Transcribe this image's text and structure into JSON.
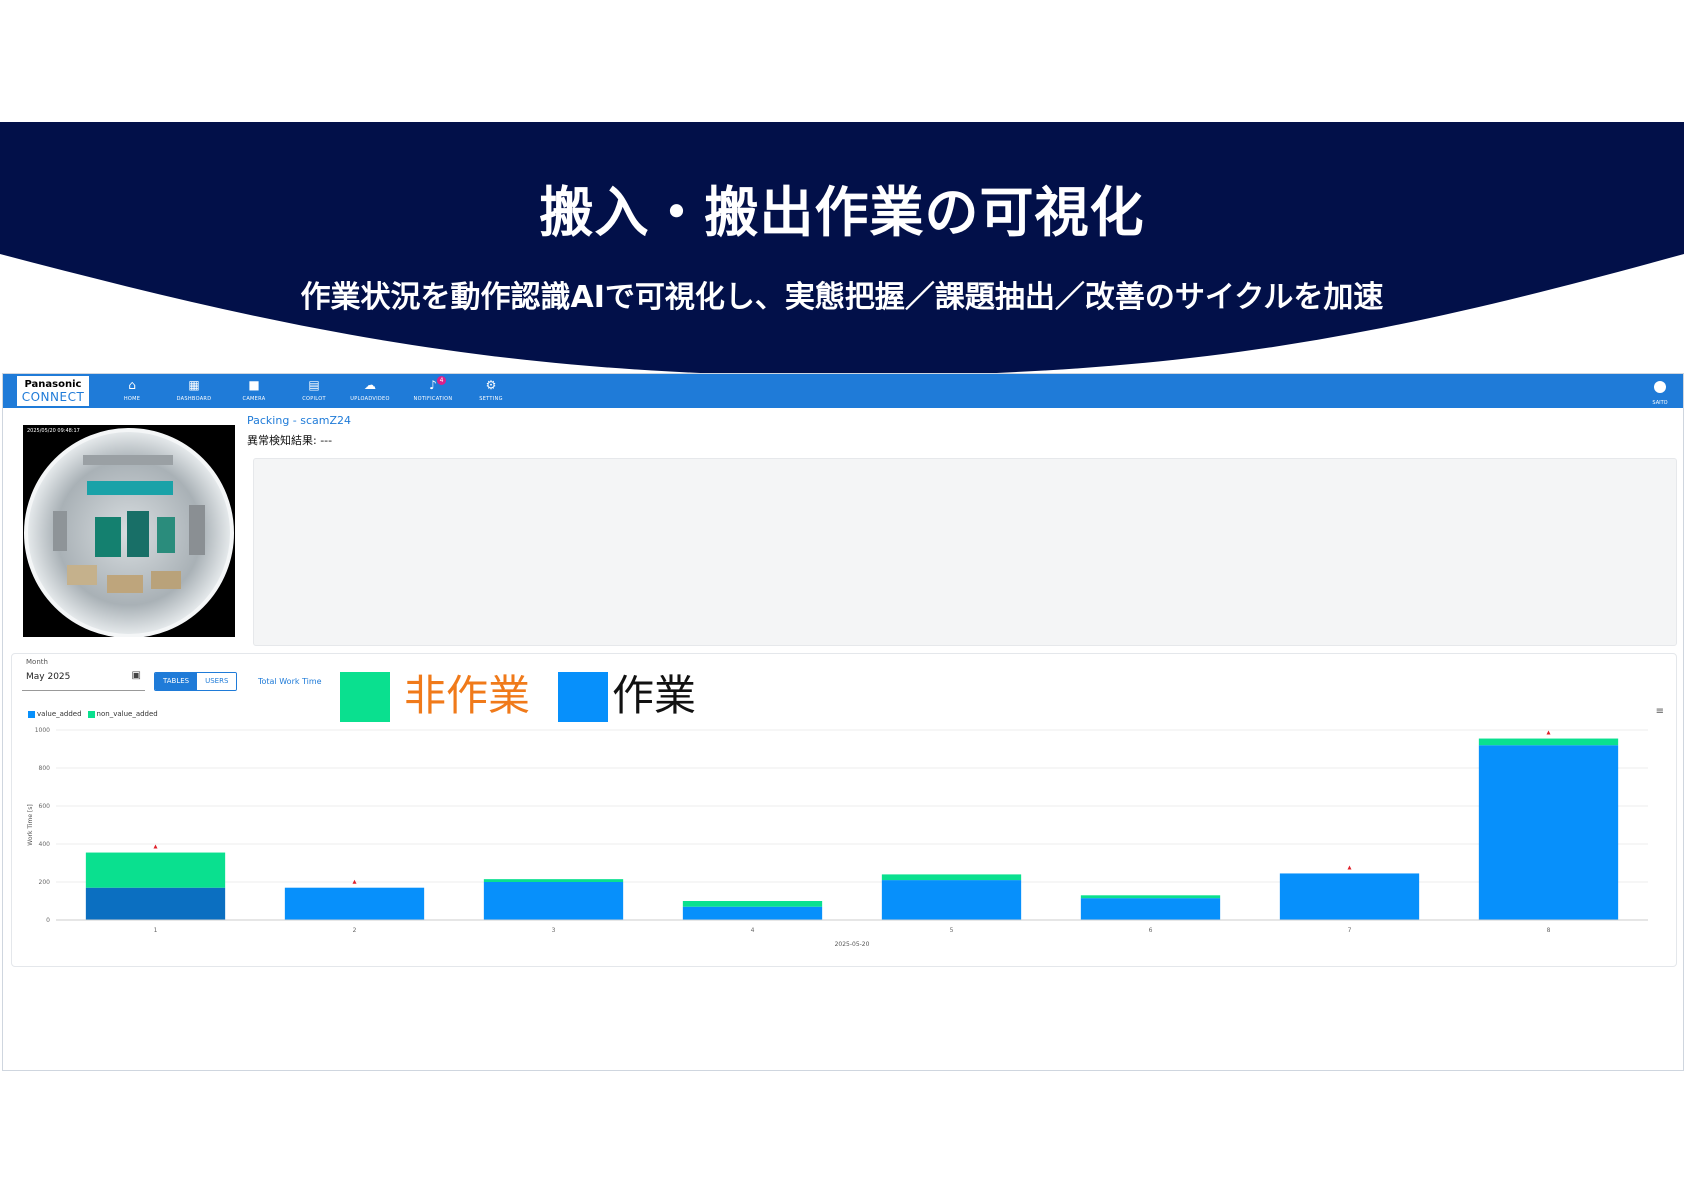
{
  "slide": {
    "title": "搬入・搬出作業の可視化",
    "subtitle": "作業状況を動作認識AIで可視化し、実態把握／課題抽出／改善のサイクルを加速"
  },
  "navbar": {
    "logo_line1": "Panasonic",
    "logo_line2": "CONNECT",
    "items": [
      {
        "label": "HOME",
        "icon": "home-icon"
      },
      {
        "label": "DASHBOARD",
        "icon": "dashboard-icon"
      },
      {
        "label": "CAMERA",
        "icon": "camera-icon"
      },
      {
        "label": "COPILOT",
        "icon": "chat-icon"
      },
      {
        "label": "UPLOADVIDEO",
        "icon": "cloud-upload-icon"
      },
      {
        "label": "NOTIFICATION",
        "icon": "bell-icon",
        "badge": "4"
      },
      {
        "label": "SETTING",
        "icon": "gear-icon"
      }
    ],
    "user_label": "SAITO"
  },
  "camera": {
    "timestamp": "2025/05/20 09:48:17",
    "title": "Packing - scamZ24",
    "result_label": "異常検知結果: ---"
  },
  "controls": {
    "month_label": "Month",
    "month_value": "May 2025",
    "toggle_options": [
      "TABLES",
      "USERS"
    ],
    "toggle_selected": "TABLES",
    "total_link": "Total Work Time"
  },
  "overlay_legend": {
    "non_work_label": "非作業",
    "non_work_color": "#0ae08f",
    "non_work_text_color": "#f07a1a",
    "work_label": "作業",
    "work_color": "#0790fb",
    "work_text_color": "#111111"
  },
  "chart_data": {
    "type": "bar",
    "stacked": true,
    "categories": [
      "1",
      "2",
      "3",
      "4",
      "5",
      "6",
      "7",
      "8"
    ],
    "series": [
      {
        "name": "value_added",
        "color": "#0790fb",
        "values": [
          170,
          170,
          200,
          70,
          210,
          115,
          245,
          920
        ]
      },
      {
        "name": "non_value_added",
        "color": "#0ae08f",
        "values": [
          185,
          0,
          15,
          30,
          30,
          15,
          0,
          35
        ]
      }
    ],
    "first_bar_value_added_color": "#0b6fc1",
    "markers": [
      true,
      true,
      false,
      false,
      false,
      false,
      true,
      true
    ],
    "marker_color": "#e0202a",
    "ylim": [
      0,
      1000
    ],
    "yticks": [
      "1000",
      "800",
      "600",
      "400",
      "200",
      "0"
    ],
    "ylabel": "Work Time [s]",
    "xlabel": "2025-05-20",
    "legend_position": "top-left",
    "grid": true
  }
}
